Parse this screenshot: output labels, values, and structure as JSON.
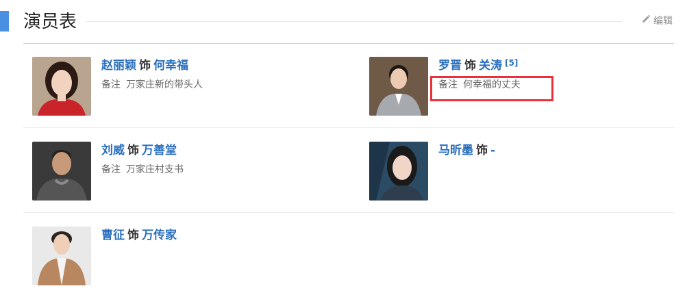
{
  "section": {
    "title": "演员表",
    "edit_label": "编辑",
    "edit_icon": "pencil-icon",
    "accent_color": "#4a90e2"
  },
  "cast": [
    {
      "actor": "赵丽颖",
      "as": "饰",
      "role": "何幸福",
      "citation": "",
      "note_label": "备注",
      "note": "万家庄新的带头人",
      "photo_colors": {
        "bg": "#b9a58f",
        "hair": "#2b1a14",
        "skin": "#f2d3c0",
        "clothes": "#c8242a"
      }
    },
    {
      "actor": "罗晋",
      "as": "饰",
      "role": "关涛",
      "citation": "[5]",
      "note_label": "备注",
      "note": "何幸福的丈夫",
      "photo_colors": {
        "bg": "#6f5a48",
        "hair": "#1d1713",
        "skin": "#eccbb2",
        "clothes": "#a6a9ad"
      }
    },
    {
      "actor": "刘威",
      "as": "饰",
      "role": "万善堂",
      "citation": "",
      "note_label": "备注",
      "note": "万家庄村支书",
      "photo_colors": {
        "bg": "#3a3a3a",
        "hair": "#222222",
        "skin": "#c79a7a",
        "clothes": "#555555"
      }
    },
    {
      "actor": "马昕墨",
      "as": "饰",
      "role": "-",
      "citation": "",
      "note_label": "",
      "note": "",
      "photo_colors": {
        "bg": "#2b4a63",
        "hair": "#1a1a1a",
        "skin": "#f1d6c8",
        "clothes": "#2f3e4e"
      }
    },
    {
      "actor": "曹征",
      "as": "饰",
      "role": "万传家",
      "citation": "",
      "note_label": "",
      "note": "",
      "photo_colors": {
        "bg": "#e9e9e9",
        "hair": "#2a2420",
        "skin": "#efcfb8",
        "clothes": "#b8875f"
      }
    }
  ],
  "highlight_color": "#e8313a"
}
